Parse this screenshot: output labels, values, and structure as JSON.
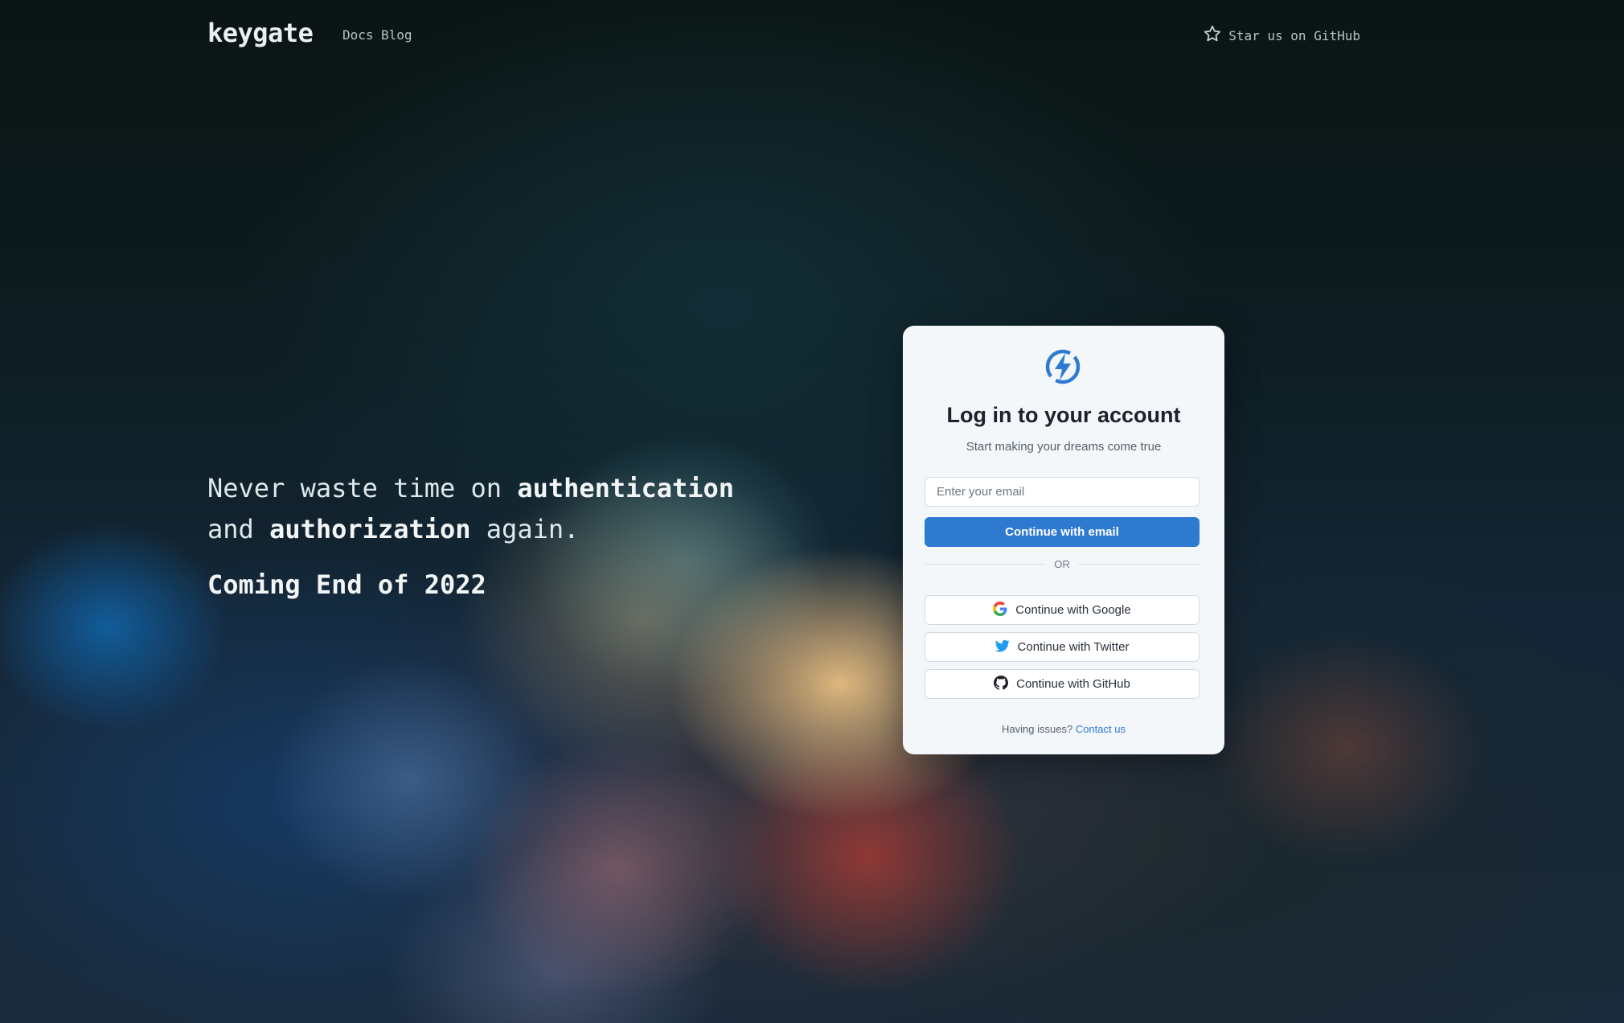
{
  "nav": {
    "brand": "keygate",
    "links": [
      {
        "label": "Docs"
      },
      {
        "label": "Blog"
      }
    ],
    "github_label": "Star us on GitHub"
  },
  "hero": {
    "line1_plain": "Never waste time on ",
    "line1_bold": "authentication",
    "line2_plain_start": "and ",
    "line2_bold": "authorization",
    "line2_plain_end": " again.",
    "coming": "Coming End of 2022"
  },
  "login": {
    "title": "Log in to your account",
    "subtitle": "Start making your dreams come true",
    "email_placeholder": "Enter your email",
    "email_value": "",
    "continue_email": "Continue with email",
    "or": "OR",
    "google": "Continue with Google",
    "twitter": "Continue with Twitter",
    "github": "Continue with GitHub",
    "help_text": "Having issues?",
    "help_link": "Contact us"
  },
  "colors": {
    "accent": "#2f7ad1",
    "card_bg": "#f3f7fa",
    "twitter_blue": "#1d9bf0"
  },
  "icons": {
    "logo": "bolt-circle-icon",
    "star": "star-icon",
    "google": "google-icon",
    "twitter": "twitter-icon",
    "github": "github-icon"
  }
}
